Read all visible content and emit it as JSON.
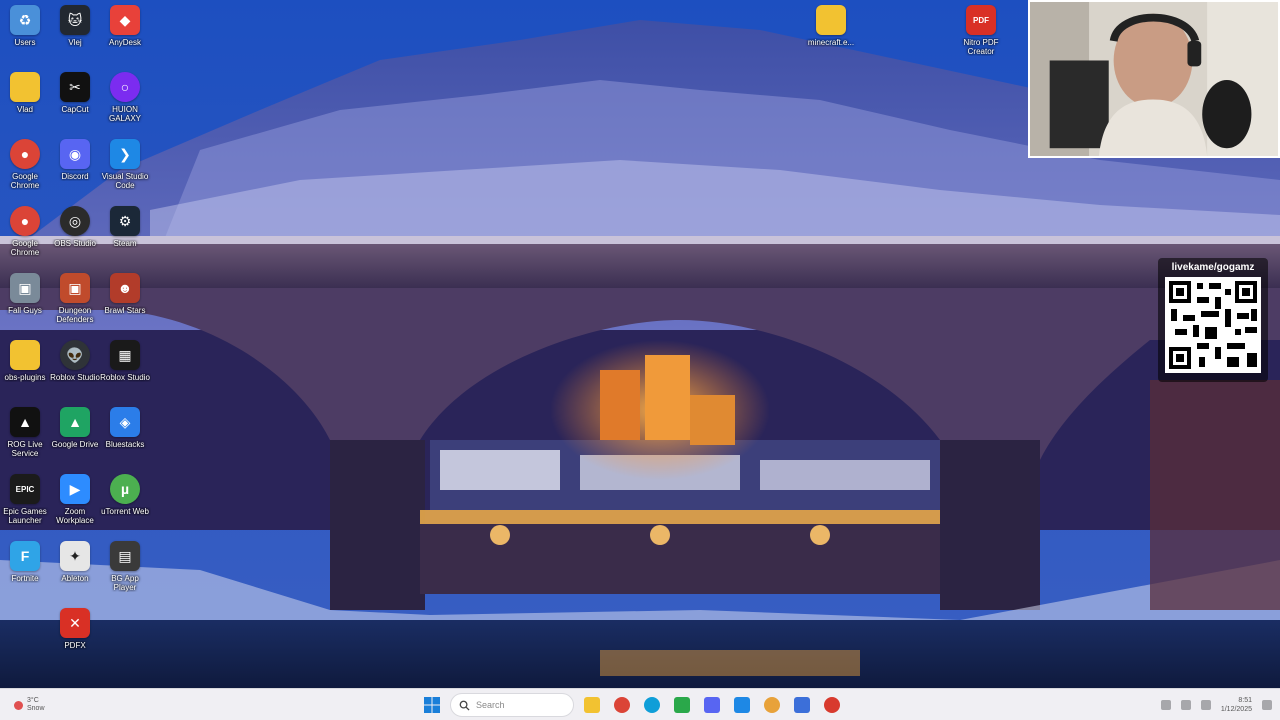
{
  "desktop": {
    "icons": [
      {
        "label": "Users",
        "icon": "recycle-bin-icon",
        "color": "#4a90d9"
      },
      {
        "label": "Vlej",
        "icon": "cat-app-icon",
        "color": "#222831"
      },
      {
        "label": "AnyDesk",
        "icon": "anydesk-icon",
        "color": "#e8413a"
      },
      {
        "label": "Vlad",
        "icon": "folder-icon",
        "color": "#f2c231"
      },
      {
        "label": "CapCut",
        "icon": "capcut-icon",
        "color": "#111111"
      },
      {
        "label": "HUION GALAXY",
        "icon": "ring-app-icon",
        "color": "#7b2cf0"
      },
      {
        "label": "Google Chrome",
        "icon": "chrome-icon",
        "color": "#db4437"
      },
      {
        "label": "Discord",
        "icon": "discord-icon",
        "color": "#5865f2"
      },
      {
        "label": "Visual Studio Code",
        "icon": "vscode-icon",
        "color": "#1e88e5"
      },
      {
        "label": "Google Chrome",
        "icon": "chrome-icon",
        "color": "#db4437"
      },
      {
        "label": "OBS Studio",
        "icon": "obs-icon",
        "color": "#2b2b2b"
      },
      {
        "label": "Steam",
        "icon": "steam-icon",
        "color": "#1b2838"
      },
      {
        "label": "Fall Guys",
        "icon": "game-icon",
        "color": "#7a8a99"
      },
      {
        "label": "Dungeon Defenders",
        "icon": "game-icon",
        "color": "#c04b2c"
      },
      {
        "label": "Brawl Stars",
        "icon": "game-icon",
        "color": "#b23c2a"
      },
      {
        "label": "obs-plugins",
        "icon": "folder-icon",
        "color": "#f2c231"
      },
      {
        "label": "Roblox Studio",
        "icon": "alien-icon",
        "color": "#2f3338"
      },
      {
        "label": "Roblox Studio",
        "icon": "roblox-studio-icon",
        "color": "#1a1a1a"
      },
      {
        "label": "ROG Live Service",
        "icon": "rog-icon",
        "color": "#111111"
      },
      {
        "label": "Google Drive",
        "icon": "google-drive-icon",
        "color": "#1fa463"
      },
      {
        "label": "Bluestacks",
        "icon": "bluestacks-icon",
        "color": "#2b7de9"
      },
      {
        "label": "Epic Games Launcher",
        "icon": "epic-games-icon",
        "color": "#1b1b1b"
      },
      {
        "label": "Zoom Workplace",
        "icon": "zoom-icon",
        "color": "#2d8cff"
      },
      {
        "label": "uTorrent Web",
        "icon": "utorrent-icon",
        "color": "#4caf50"
      },
      {
        "label": "Fortnite",
        "icon": "fortnite-icon",
        "color": "#2fa4e7"
      },
      {
        "label": "Ableton",
        "icon": "star-app-icon",
        "color": "#e6e6e6"
      },
      {
        "label": "BG App Player",
        "icon": "grid-app-icon",
        "color": "#3a3a3a"
      },
      {
        "label": "PDFX",
        "icon": "pdf-icon",
        "color": "#d93025"
      }
    ],
    "top_icons": [
      {
        "label": "minecraft.e...",
        "icon": "folder-icon",
        "color": "#f2c231"
      },
      {
        "label": "Nitro PDF Creator",
        "icon": "pdf-icon",
        "color": "#d93025"
      }
    ]
  },
  "overlay": {
    "qr_caption": "livekame/gogamz"
  },
  "taskbar": {
    "weather_text": "3°C",
    "weather_sub": "Snow",
    "search_placeholder": "Search",
    "clock_time": "8:51",
    "clock_date": "1/12/2025",
    "apps": [
      {
        "icon": "file-explorer-icon",
        "color": "#f2c231"
      },
      {
        "icon": "chrome-icon",
        "color": "#db4437"
      },
      {
        "icon": "edge-icon",
        "color": "#0f9ed8"
      },
      {
        "icon": "xbox-icon",
        "color": "#2aa84a"
      },
      {
        "icon": "discord-icon",
        "color": "#5865f2"
      },
      {
        "icon": "vscode-icon",
        "color": "#1e88e5"
      },
      {
        "icon": "chrome-icon",
        "color": "#e8a23a"
      },
      {
        "icon": "app-blue-icon",
        "color": "#3c6fd9"
      },
      {
        "icon": "app-red-icon",
        "color": "#d83a2e"
      }
    ]
  }
}
